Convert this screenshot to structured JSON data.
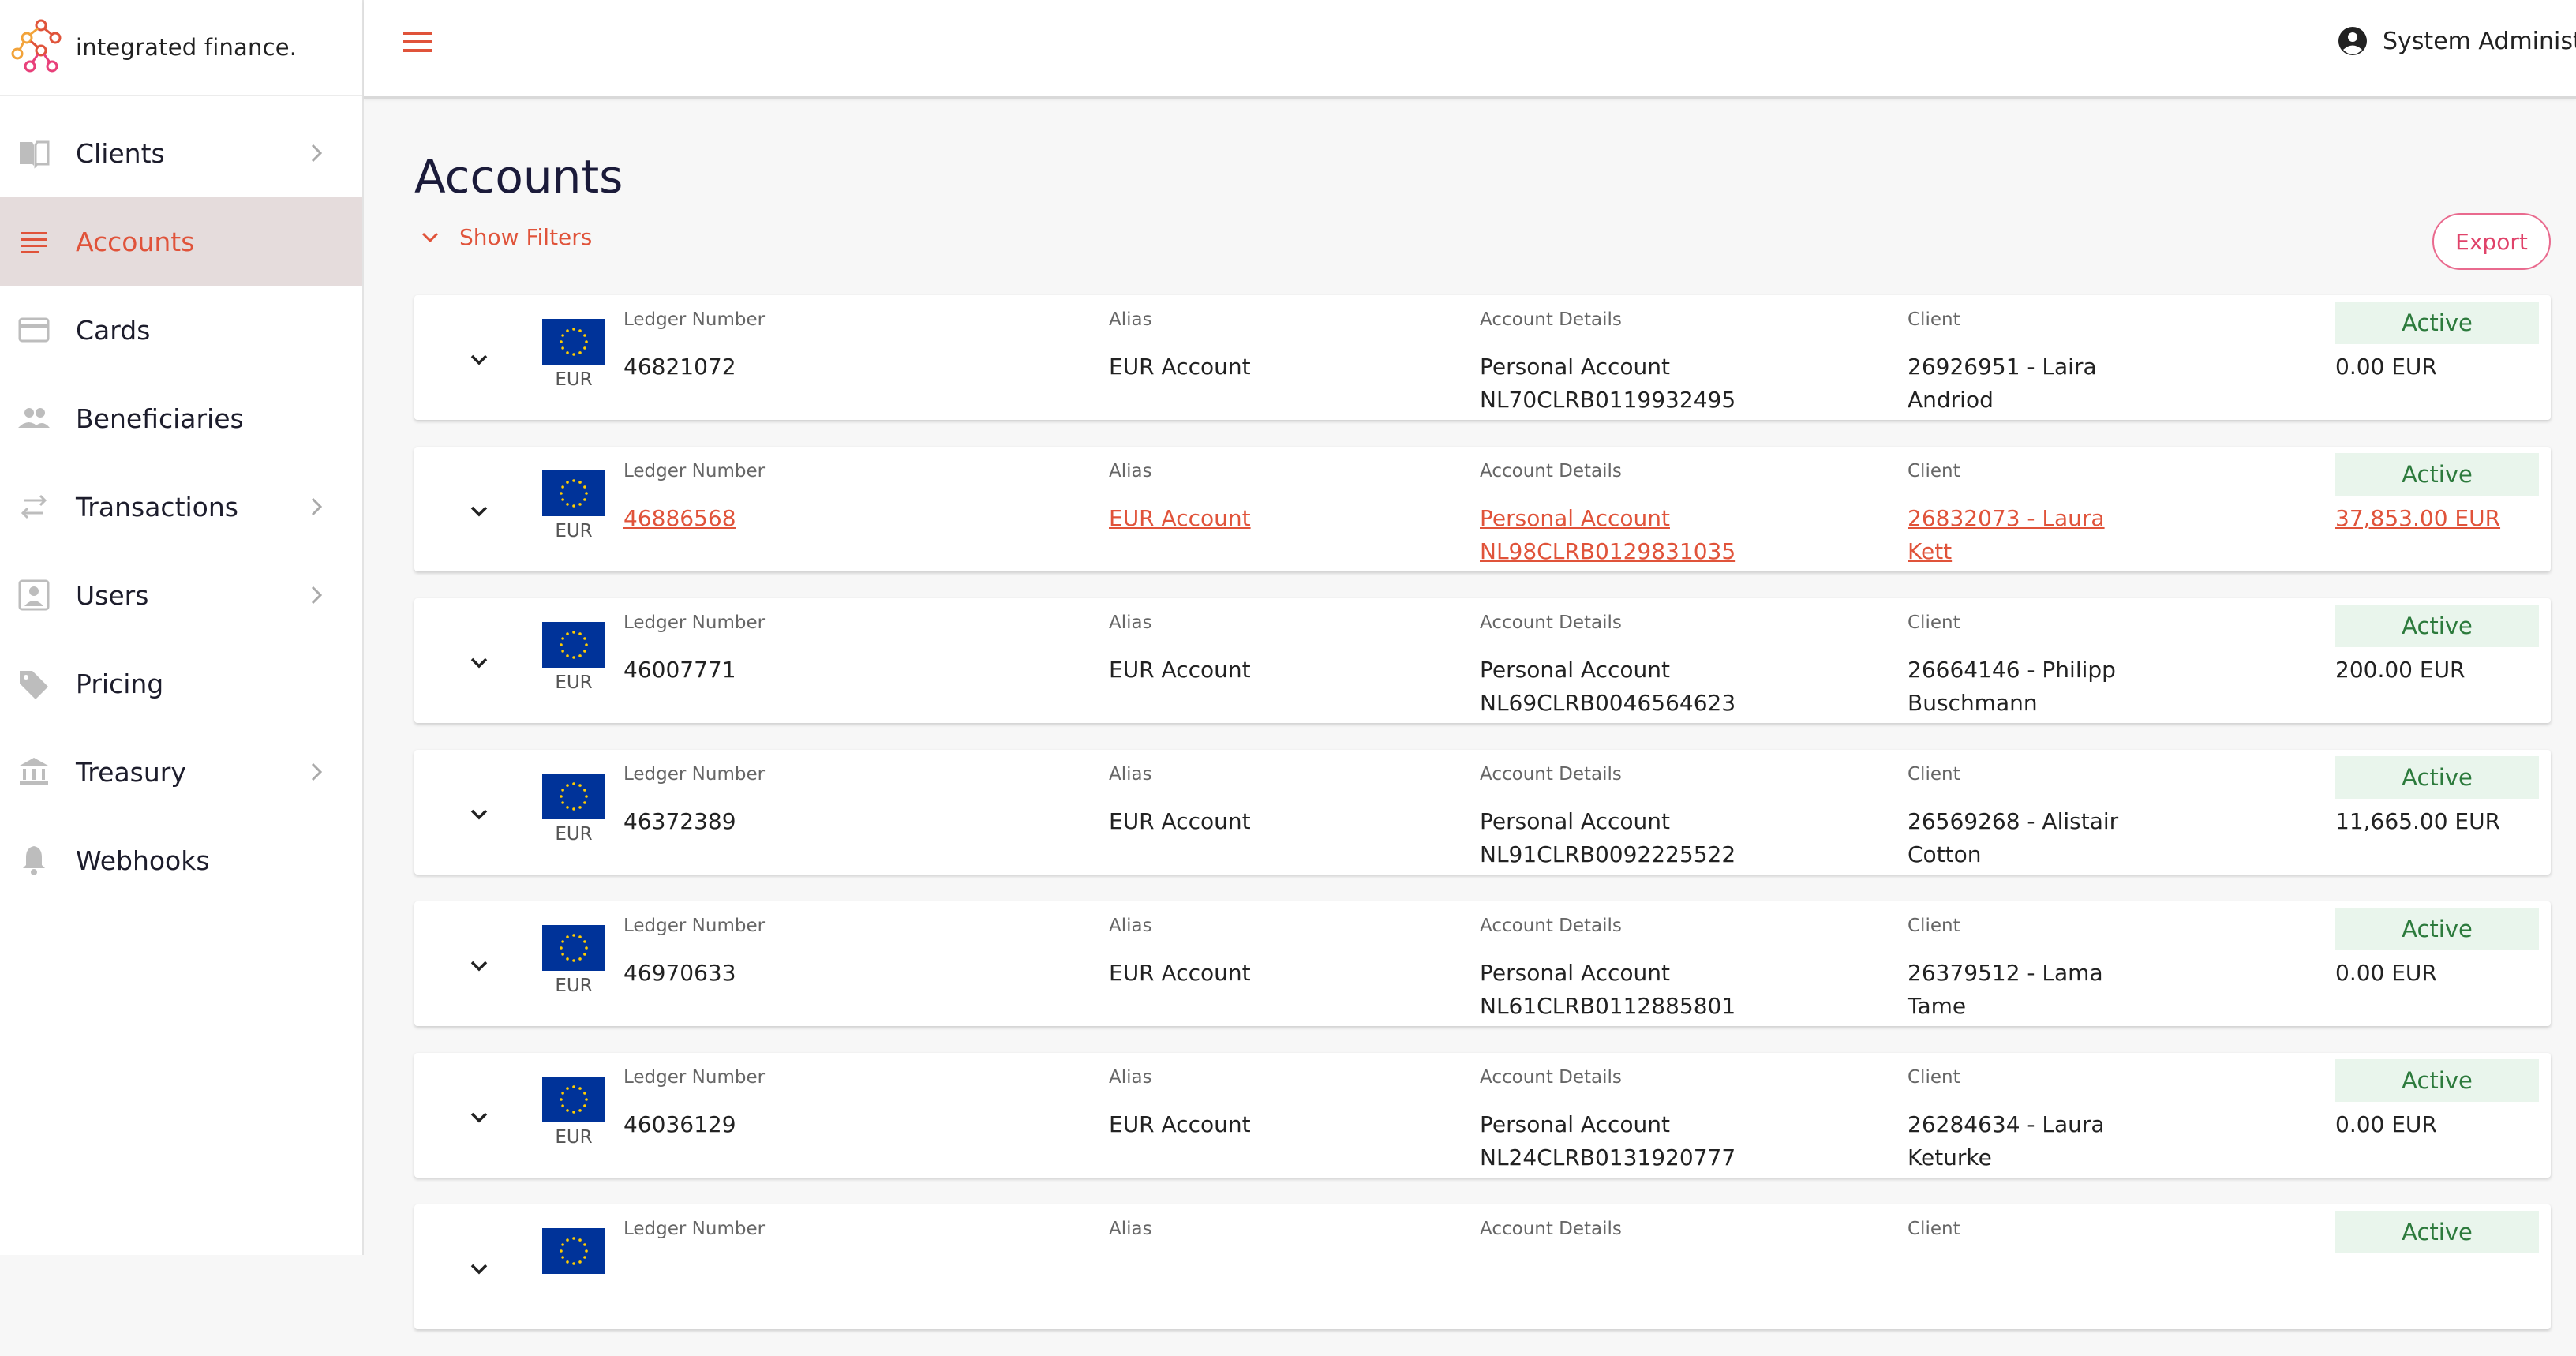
{
  "brand": {
    "name": "integrated finance.",
    "accent": "#e0533a"
  },
  "sidebar": {
    "items": [
      {
        "label": "Clients",
        "icon": "book-icon",
        "chevron": true
      },
      {
        "label": "Accounts",
        "icon": "list-icon",
        "chevron": false,
        "active": true
      },
      {
        "label": "Cards",
        "icon": "card-icon",
        "chevron": false
      },
      {
        "label": "Beneficiaries",
        "icon": "people-icon",
        "chevron": false
      },
      {
        "label": "Transactions",
        "icon": "transfer-icon",
        "chevron": true
      },
      {
        "label": "Users",
        "icon": "user-box-icon",
        "chevron": true
      },
      {
        "label": "Pricing",
        "icon": "tag-icon",
        "chevron": false
      },
      {
        "label": "Treasury",
        "icon": "bank-icon",
        "chevron": true
      },
      {
        "label": "Webhooks",
        "icon": "bell-icon",
        "chevron": false
      }
    ]
  },
  "header": {
    "user_name": "System Administrat"
  },
  "page": {
    "title": "Accounts",
    "filters_label": "Show Filters",
    "export_label": "Export"
  },
  "columns": {
    "ledger": "Ledger Number",
    "alias": "Alias",
    "details": "Account Details",
    "client": "Client"
  },
  "accounts": [
    {
      "currency": "EUR",
      "ledger": "46821072",
      "alias": "EUR Account",
      "type": "Personal Account",
      "iban": "NL70CLRB0119932495",
      "client": "26926951 - Laira Andriod",
      "status": "Active",
      "balance": "0.00 EUR",
      "link": false
    },
    {
      "currency": "EUR",
      "ledger": "46886568",
      "alias": "EUR Account",
      "type": "Personal Account",
      "iban": "NL98CLRB0129831035",
      "client": "26832073 - Laura Kett",
      "status": "Active",
      "balance": "37,853.00 EUR",
      "link": true
    },
    {
      "currency": "EUR",
      "ledger": "46007771",
      "alias": "EUR Account",
      "type": "Personal Account",
      "iban": "NL69CLRB0046564623",
      "client": "26664146 - Philipp Buschmann",
      "status": "Active",
      "balance": "200.00 EUR",
      "link": false
    },
    {
      "currency": "EUR",
      "ledger": "46372389",
      "alias": "EUR Account",
      "type": "Personal Account",
      "iban": "NL91CLRB0092225522",
      "client": "26569268 - Alistair Cotton",
      "status": "Active",
      "balance": "11,665.00 EUR",
      "link": false
    },
    {
      "currency": "EUR",
      "ledger": "46970633",
      "alias": "EUR Account",
      "type": "Personal Account",
      "iban": "NL61CLRB0112885801",
      "client": "26379512 - Lama Tame",
      "status": "Active",
      "balance": "0.00 EUR",
      "link": false
    },
    {
      "currency": "EUR",
      "ledger": "46036129",
      "alias": "EUR Account",
      "type": "Personal Account",
      "iban": "NL24CLRB0131920777",
      "client": "26284634 - Laura Keturke",
      "status": "Active",
      "balance": "0.00 EUR",
      "link": false
    },
    {
      "currency": "",
      "ledger": "",
      "alias": "",
      "type": "",
      "iban": "",
      "client": "",
      "status": "Active",
      "balance": "",
      "link": false
    }
  ]
}
